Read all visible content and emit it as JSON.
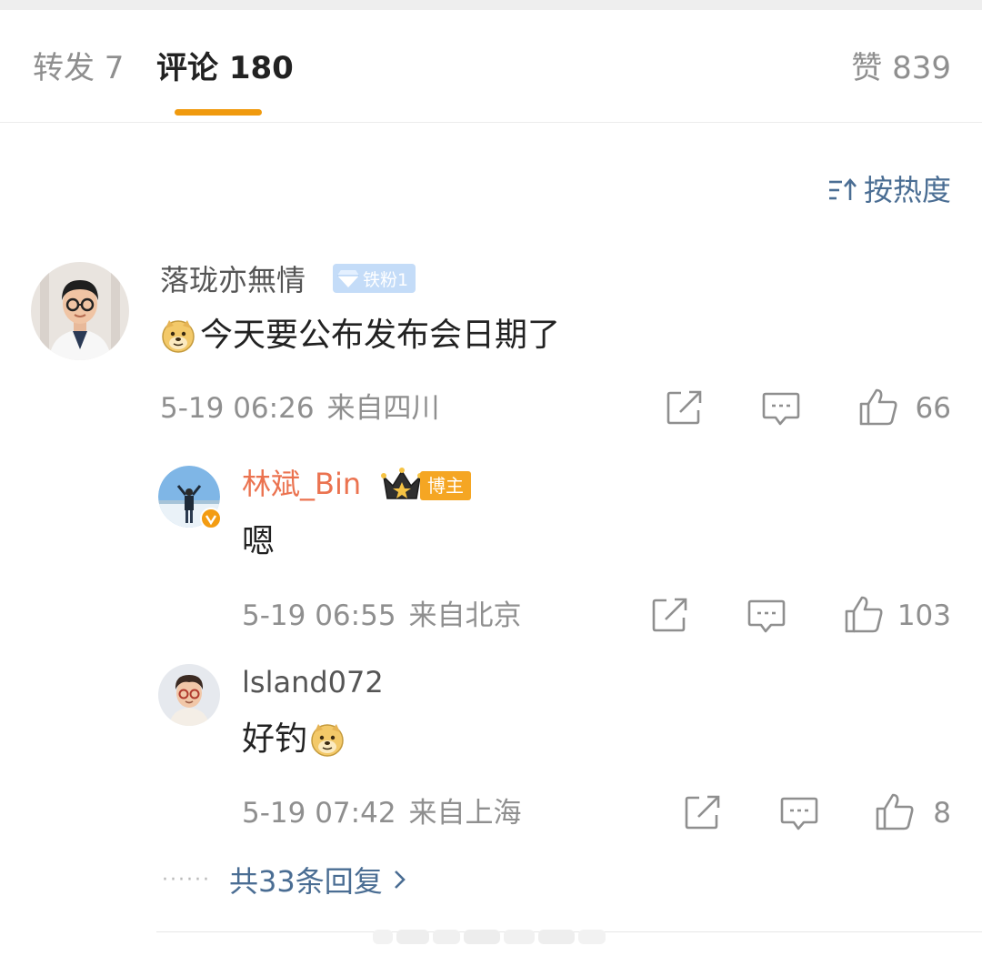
{
  "tabs": {
    "repost": "转发 7",
    "comments": "评论 180",
    "likes": "赞 839"
  },
  "sort": {
    "label": "按热度",
    "icon": "sort-lines-icon"
  },
  "comments": [
    {
      "user": "落珑亦無情",
      "badge": "铁粉1",
      "text": "今天要公布发布会日期了",
      "emoji": "doge-emoji",
      "time": "5-19 06:26",
      "location": "来自四川",
      "likes": "66",
      "replies": [
        {
          "user": "林斌_Bin",
          "user_color": "#eb7350",
          "badge": "博主",
          "text": "嗯",
          "time": "5-19 06:55",
          "location": "来自北京",
          "likes": "103"
        },
        {
          "user": "lsland072",
          "text": "好钓",
          "emoji": "doge-emoji",
          "time": "5-19 07:42",
          "location": "来自上海",
          "likes": "8"
        }
      ],
      "more_replies": "共33条回复"
    }
  ],
  "colors": {
    "accent": "#f09a0e",
    "link": "#4a6d93",
    "blogger_name": "#eb7350",
    "muted": "#8f8f8f"
  }
}
